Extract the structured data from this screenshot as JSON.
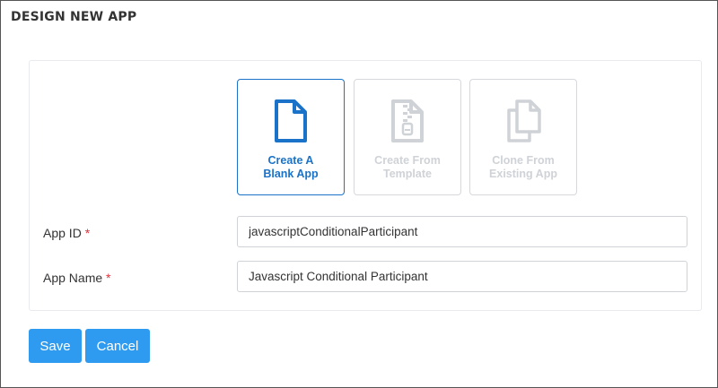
{
  "page": {
    "title": "DESIGN NEW APP"
  },
  "options": [
    {
      "label_line1": "Create A",
      "label_line2": "Blank App",
      "icon": "file-icon",
      "selected": true
    },
    {
      "label_line1": "Create From",
      "label_line2": "Template",
      "icon": "zip-file-icon",
      "selected": false
    },
    {
      "label_line1": "Clone From",
      "label_line2": "Existing App",
      "icon": "copy-files-icon",
      "selected": false
    }
  ],
  "form": {
    "app_id": {
      "label": "App ID",
      "required_mark": "*",
      "value": "javascriptConditionalParticipant"
    },
    "app_name": {
      "label": "App Name",
      "required_mark": "*",
      "value": "Javascript Conditional Participant"
    }
  },
  "actions": {
    "save_label": "Save",
    "cancel_label": "Cancel"
  },
  "colors": {
    "accent": "#1a73c8",
    "button": "#2f9bf0",
    "disabled": "#cfd2d6",
    "required": "#e0303a"
  }
}
